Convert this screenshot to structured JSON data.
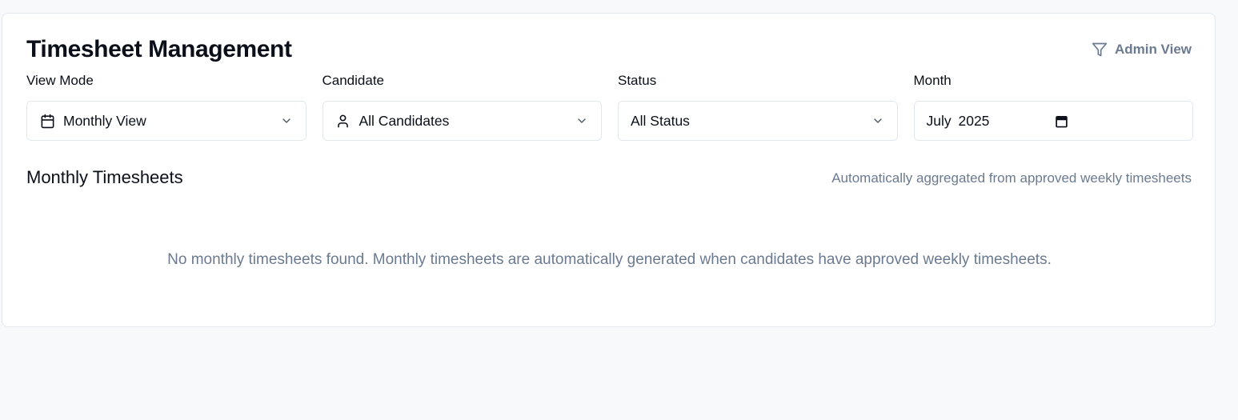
{
  "header": {
    "title": "Timesheet Management",
    "admin_view_label": "Admin View",
    "admin_view_icon": "filter-icon"
  },
  "filters": {
    "view_mode": {
      "label": "View Mode",
      "value": "Monthly View",
      "icon": "calendar-icon"
    },
    "candidate": {
      "label": "Candidate",
      "value": "All Candidates",
      "icon": "user-icon"
    },
    "status": {
      "label": "Status",
      "value": "All Status"
    },
    "month": {
      "label": "Month",
      "value": "July 2025",
      "icon": "calendar-icon"
    }
  },
  "section": {
    "title": "Monthly Timesheets",
    "note": "Automatically aggregated from approved weekly timesheets",
    "empty_message": "No monthly timesheets found. Monthly timesheets are automatically generated when candidates have approved weekly timesheets."
  },
  "colors": {
    "page_bg": "#f8f9fb",
    "card_bg": "#ffffff",
    "border": "#e3e7ee",
    "text_primary": "#0b0f19",
    "text_muted": "#6b7a90"
  }
}
